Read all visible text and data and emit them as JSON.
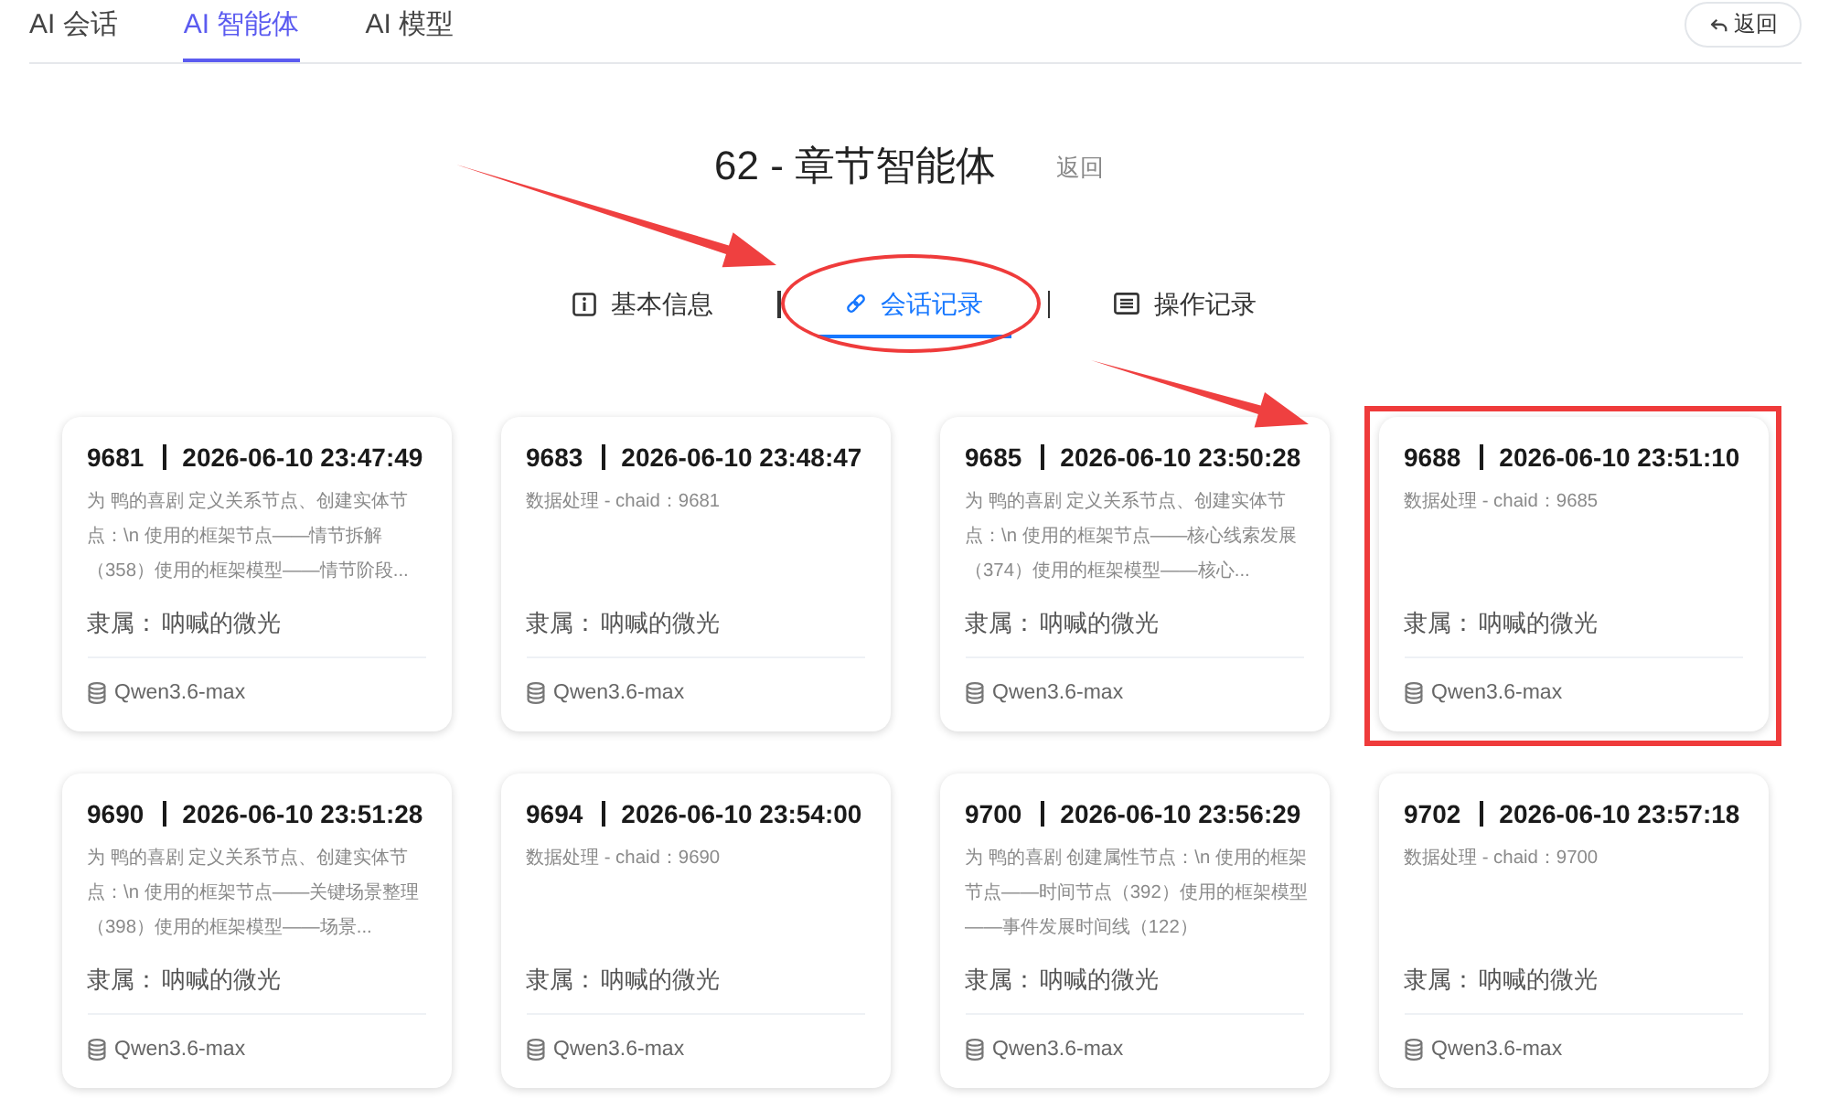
{
  "nav": {
    "tabs": [
      {
        "label": "AI 会话",
        "selected": false
      },
      {
        "label": "AI 智能体",
        "selected": true
      },
      {
        "label": "AI 模型",
        "selected": false
      }
    ],
    "back_button": "返回"
  },
  "header": {
    "title": "62 - 章节智能体",
    "back_link": "返回"
  },
  "sub_tabs": [
    {
      "label": "基本信息",
      "selected": false,
      "circled": false
    },
    {
      "label": "会话记录",
      "selected": true,
      "circled": true
    },
    {
      "label": "操作记录",
      "selected": false,
      "circled": false
    }
  ],
  "cards": [
    {
      "id": "9681",
      "time": "2026-06-10 23:47:49",
      "description": "为 鸭的喜剧 定义关系节点、创建实体节点：\\n 使用的框架节点——情节拆解（358）使用的框架模型——情节阶段...",
      "owner_label": "隶属：",
      "owner": "呐喊的微光",
      "model": "Qwen3.6-max",
      "highlighted": false
    },
    {
      "id": "9683",
      "time": "2026-06-10 23:48:47",
      "description": "数据处理 - chaid：9681",
      "owner_label": "隶属：",
      "owner": "呐喊的微光",
      "model": "Qwen3.6-max",
      "highlighted": false
    },
    {
      "id": "9685",
      "time": "2026-06-10 23:50:28",
      "description": "为 鸭的喜剧 定义关系节点、创建实体节点：\\n 使用的框架节点——核心线索发展（374）使用的框架模型——核心...",
      "owner_label": "隶属：",
      "owner": "呐喊的微光",
      "model": "Qwen3.6-max",
      "highlighted": false
    },
    {
      "id": "9688",
      "time": "2026-06-10 23:51:10",
      "description": "数据处理 - chaid：9685",
      "owner_label": "隶属：",
      "owner": "呐喊的微光",
      "model": "Qwen3.6-max",
      "highlighted": true
    },
    {
      "id": "9690",
      "time": "2026-06-10 23:51:28",
      "description": "为 鸭的喜剧 定义关系节点、创建实体节点：\\n 使用的框架节点——关键场景整理（398）使用的框架模型——场景...",
      "owner_label": "隶属：",
      "owner": "呐喊的微光",
      "model": "Qwen3.6-max",
      "highlighted": false
    },
    {
      "id": "9694",
      "time": "2026-06-10 23:54:00",
      "description": "数据处理 - chaid：9690",
      "owner_label": "隶属：",
      "owner": "呐喊的微光",
      "model": "Qwen3.6-max",
      "highlighted": false
    },
    {
      "id": "9700",
      "time": "2026-06-10 23:56:29",
      "description": "为 鸭的喜剧 创建属性节点：\\n 使用的框架节点——时间节点（392）使用的框架模型——事件发展时间线（122）",
      "owner_label": "隶属：",
      "owner": "呐喊的微光",
      "model": "Qwen3.6-max",
      "highlighted": false
    },
    {
      "id": "9702",
      "time": "2026-06-10 23:57:18",
      "description": "数据处理 - chaid：9700",
      "owner_label": "隶属：",
      "owner": "呐喊的微光",
      "model": "Qwen3.6-max",
      "highlighted": false
    }
  ]
}
